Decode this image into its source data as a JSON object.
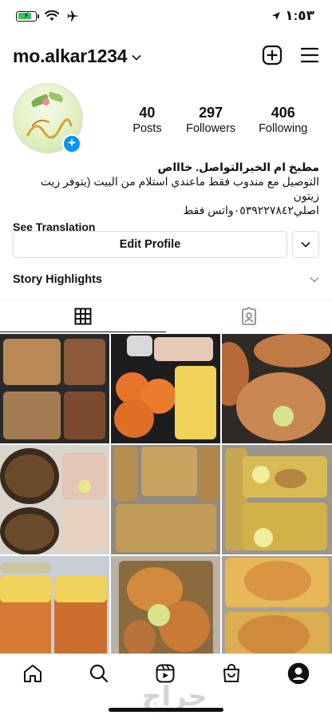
{
  "status_bar": {
    "time": "١:٥٣"
  },
  "header": {
    "username": "mo.alkar1234"
  },
  "profile": {
    "stats": [
      {
        "count": "40",
        "label": "Posts"
      },
      {
        "count": "297",
        "label": "Followers"
      },
      {
        "count": "406",
        "label": "Following"
      }
    ],
    "bio": {
      "name": "مطبخ ام الخيرالتواصل. خاااص",
      "line1": "التوصيل مع مندوب فقط ماعندي استلام من البيت (يتوفر زيت زيتون",
      "line2": "اصلي٠٥٣٩٢٢٧٨٤٢واتس فقط",
      "see_translation": "See Translation"
    },
    "edit_profile_label": "Edit Profile",
    "story_highlights_label": "Story Highlights"
  },
  "tabs": [
    {
      "name": "grid",
      "icon": "grid-icon",
      "active": true
    },
    {
      "name": "tagged",
      "icon": "tagged-icon",
      "active": false
    }
  ],
  "posts": [
    {
      "icon": "food-photo"
    },
    {
      "icon": "food-photo"
    },
    {
      "icon": "food-photo"
    },
    {
      "icon": "food-photo"
    },
    {
      "icon": "food-photo"
    },
    {
      "icon": "food-photo"
    },
    {
      "icon": "food-photo"
    },
    {
      "icon": "food-photo"
    },
    {
      "icon": "food-photo"
    }
  ],
  "bottom_nav": [
    "home-icon",
    "search-icon",
    "reels-icon",
    "shop-icon",
    "profile-icon"
  ],
  "watermark": "حراج",
  "colors": {
    "accent": "#0095f6",
    "border": "#dbdbdb",
    "battery": "#34c759"
  }
}
